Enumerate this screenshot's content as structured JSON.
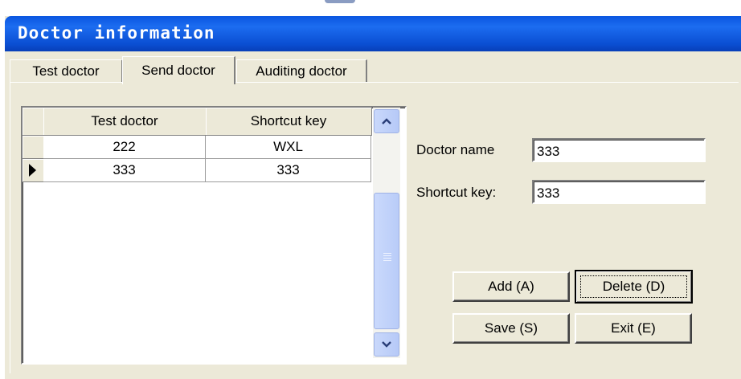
{
  "window": {
    "title": "Doctor information"
  },
  "tabs": [
    {
      "label": "Test doctor",
      "active": false
    },
    {
      "label": "Send doctor",
      "active": true
    },
    {
      "label": "Auditing doctor",
      "active": false
    }
  ],
  "grid": {
    "columns": [
      "Test doctor",
      "Shortcut key"
    ],
    "rows": [
      {
        "doctor": "222",
        "shortcut": "WXL",
        "current": false
      },
      {
        "doctor": "333",
        "shortcut": "333",
        "current": true
      }
    ]
  },
  "form": {
    "doctor_name_label": "Doctor name",
    "doctor_name_value": "333",
    "shortcut_label": "Shortcut key:",
    "shortcut_value": "333"
  },
  "buttons": {
    "add": "Add (A)",
    "delete": "Delete (D)",
    "save": "Save (S)",
    "exit": "Exit (E)"
  }
}
